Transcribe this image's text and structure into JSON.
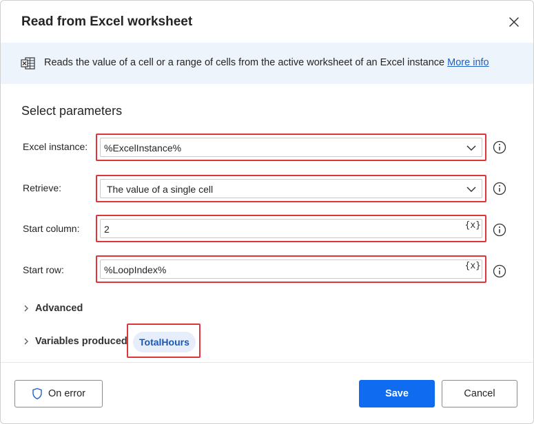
{
  "dialog": {
    "title": "Read from Excel worksheet",
    "close_icon": "close-icon"
  },
  "banner": {
    "icon": "excel-icon",
    "description": "Reads the value of a cell or a range of cells from the active worksheet of an Excel instance",
    "link_label": "More info"
  },
  "section": {
    "title": "Select parameters"
  },
  "params": {
    "excel_instance": {
      "label": "Excel instance:",
      "value": "%ExcelInstance%"
    },
    "retrieve": {
      "label": "Retrieve:",
      "value": "The value of a single cell"
    },
    "start_column": {
      "label": "Start column:",
      "value": "2",
      "var_button": "{x}"
    },
    "start_row": {
      "label": "Start row:",
      "value": "%LoopIndex%",
      "var_button": "{x}"
    }
  },
  "advanced": {
    "label": "Advanced"
  },
  "variables": {
    "label": "Variables produced",
    "items": [
      "TotalHours"
    ]
  },
  "footer": {
    "on_error_label": "On error",
    "save_label": "Save",
    "cancel_label": "Cancel"
  },
  "colors": {
    "accent": "#0f6cf0",
    "highlight": "#e0333a",
    "banner_bg": "#eef4fc",
    "link": "#1a5fc7"
  }
}
